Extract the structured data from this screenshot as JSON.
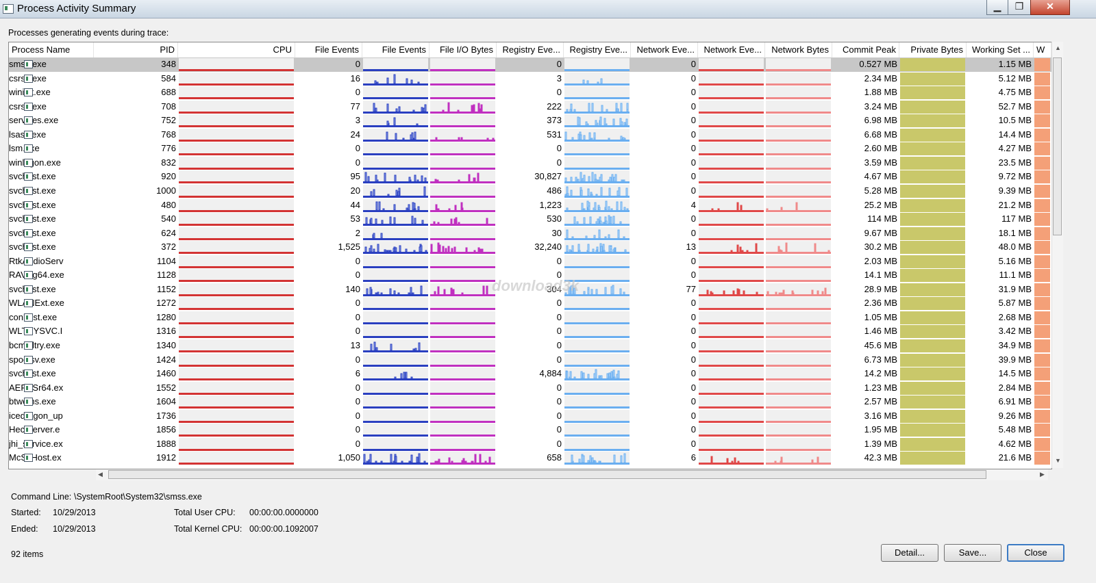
{
  "window": {
    "title": "Process Activity Summary"
  },
  "subtitle": "Processes generating events during trace:",
  "columns": [
    "Process Name",
    "PID",
    "CPU",
    "File Events",
    "File Events",
    "File I/O Bytes",
    "Registry Eve...",
    "Registry Eve...",
    "Network Eve...",
    "Network Eve...",
    "Network Bytes",
    "Commit Peak",
    "Private Bytes",
    "Working Set ...",
    "W"
  ],
  "rows": [
    {
      "name": "smss.exe",
      "pid": "348",
      "file": "0",
      "reg": "0",
      "net": "0",
      "commit": "0.527 MB",
      "ws": "1.15 MB"
    },
    {
      "name": "csrss.exe",
      "pid": "584",
      "file": "16",
      "reg": "3",
      "net": "0",
      "commit": "2.34 MB",
      "ws": "5.12 MB"
    },
    {
      "name": "wininit.exe",
      "pid": "688",
      "file": "0",
      "reg": "0",
      "net": "0",
      "commit": "1.88 MB",
      "ws": "4.75 MB"
    },
    {
      "name": "csrss.exe",
      "pid": "708",
      "file": "77",
      "reg": "222",
      "net": "0",
      "commit": "3.24 MB",
      "ws": "52.7 MB"
    },
    {
      "name": "services.exe",
      "pid": "752",
      "file": "3",
      "reg": "373",
      "net": "0",
      "commit": "6.98 MB",
      "ws": "10.5 MB"
    },
    {
      "name": "lsass.exe",
      "pid": "768",
      "file": "24",
      "reg": "531",
      "net": "0",
      "commit": "6.68 MB",
      "ws": "14.4 MB"
    },
    {
      "name": "lsm.exe",
      "pid": "776",
      "file": "0",
      "reg": "0",
      "net": "0",
      "commit": "2.60 MB",
      "ws": "4.27 MB"
    },
    {
      "name": "winlogon.exe",
      "pid": "832",
      "file": "0",
      "reg": "0",
      "net": "0",
      "commit": "3.59 MB",
      "ws": "23.5 MB"
    },
    {
      "name": "svchost.exe",
      "pid": "920",
      "file": "95",
      "reg": "30,827",
      "net": "0",
      "commit": "4.67 MB",
      "ws": "9.72 MB"
    },
    {
      "name": "svchost.exe",
      "pid": "1000",
      "file": "20",
      "reg": "486",
      "net": "0",
      "commit": "5.28 MB",
      "ws": "9.39 MB"
    },
    {
      "name": "svchost.exe",
      "pid": "480",
      "file": "44",
      "reg": "1,223",
      "net": "4",
      "commit": "25.2 MB",
      "ws": "21.2 MB"
    },
    {
      "name": "svchost.exe",
      "pid": "540",
      "file": "53",
      "reg": "530",
      "net": "0",
      "commit": "114 MB",
      "ws": "117 MB"
    },
    {
      "name": "svchost.exe",
      "pid": "624",
      "file": "2",
      "reg": "30",
      "net": "0",
      "commit": "9.67 MB",
      "ws": "18.1 MB"
    },
    {
      "name": "svchost.exe",
      "pid": "372",
      "file": "1,525",
      "reg": "32,240",
      "net": "13",
      "commit": "30.2 MB",
      "ws": "48.0 MB"
    },
    {
      "name": "RtkAudioServ",
      "pid": "1104",
      "file": "0",
      "reg": "0",
      "net": "0",
      "commit": "2.03 MB",
      "ws": "5.16 MB"
    },
    {
      "name": "RAVBg64.exe",
      "pid": "1128",
      "file": "0",
      "reg": "0",
      "net": "0",
      "commit": "14.1 MB",
      "ws": "11.1 MB"
    },
    {
      "name": "svchost.exe",
      "pid": "1152",
      "file": "140",
      "reg": "304",
      "net": "77",
      "commit": "28.9 MB",
      "ws": "31.9 MB"
    },
    {
      "name": "WLANExt.exe",
      "pid": "1272",
      "file": "0",
      "reg": "0",
      "net": "0",
      "commit": "2.36 MB",
      "ws": "5.87 MB"
    },
    {
      "name": "conhost.exe",
      "pid": "1280",
      "file": "0",
      "reg": "0",
      "net": "0",
      "commit": "1.05 MB",
      "ws": "2.68 MB"
    },
    {
      "name": "WLTRYSVC.I",
      "pid": "1316",
      "file": "0",
      "reg": "0",
      "net": "0",
      "commit": "1.46 MB",
      "ws": "3.42 MB"
    },
    {
      "name": "bcmwltry.exe",
      "pid": "1340",
      "file": "13",
      "reg": "0",
      "net": "0",
      "commit": "45.6 MB",
      "ws": "34.9 MB"
    },
    {
      "name": "spoolsv.exe",
      "pid": "1424",
      "file": "0",
      "reg": "0",
      "net": "0",
      "commit": "6.73 MB",
      "ws": "39.9 MB"
    },
    {
      "name": "svchost.exe",
      "pid": "1460",
      "file": "6",
      "reg": "4,884",
      "net": "0",
      "commit": "14.2 MB",
      "ws": "14.5 MB"
    },
    {
      "name": "AERTSr64.ex",
      "pid": "1552",
      "file": "0",
      "reg": "0",
      "net": "0",
      "commit": "1.23 MB",
      "ws": "2.84 MB"
    },
    {
      "name": "btwdins.exe",
      "pid": "1604",
      "file": "0",
      "reg": "0",
      "net": "0",
      "commit": "2.57 MB",
      "ws": "6.91 MB"
    },
    {
      "name": "icedragon_up",
      "pid": "1736",
      "file": "0",
      "reg": "0",
      "net": "0",
      "commit": "3.16 MB",
      "ws": "9.26 MB"
    },
    {
      "name": "HeciServer.e",
      "pid": "1856",
      "file": "0",
      "reg": "0",
      "net": "0",
      "commit": "1.95 MB",
      "ws": "5.48 MB"
    },
    {
      "name": "jhi_service.ex",
      "pid": "1888",
      "file": "0",
      "reg": "0",
      "net": "0",
      "commit": "1.39 MB",
      "ws": "4.62 MB"
    },
    {
      "name": "McSvHost.ex",
      "pid": "1912",
      "file": "1,050",
      "reg": "658",
      "net": "6",
      "commit": "42.3 MB",
      "ws": "21.6 MB"
    }
  ],
  "details": {
    "command_line_label": "Command Line:",
    "command_line": "\\SystemRoot\\System32\\smss.exe",
    "started_label": "Started:",
    "started": "10/29/2013",
    "ended_label": "Ended:",
    "ended": "10/29/2013",
    "user_cpu_label": "Total User CPU:",
    "user_cpu": "00:00:00.0000000",
    "kernel_cpu_label": "Total Kernel CPU:",
    "kernel_cpu": "00:00:00.1092007"
  },
  "status": {
    "items": "92 items"
  },
  "buttons": {
    "detail": "Detail...",
    "save": "Save...",
    "close": "Close"
  },
  "watermark": "download3k",
  "colors": {
    "cpu_line": "#d33333",
    "file_events": "#2a3fc0",
    "file_io": "#c030c0",
    "registry": "#6aaef0",
    "network": "#e04848",
    "network_bytes": "#f08a8a",
    "private_bytes": "#c9c86a",
    "working_set": "#f4a078",
    "selection": "#c7c7c7"
  }
}
